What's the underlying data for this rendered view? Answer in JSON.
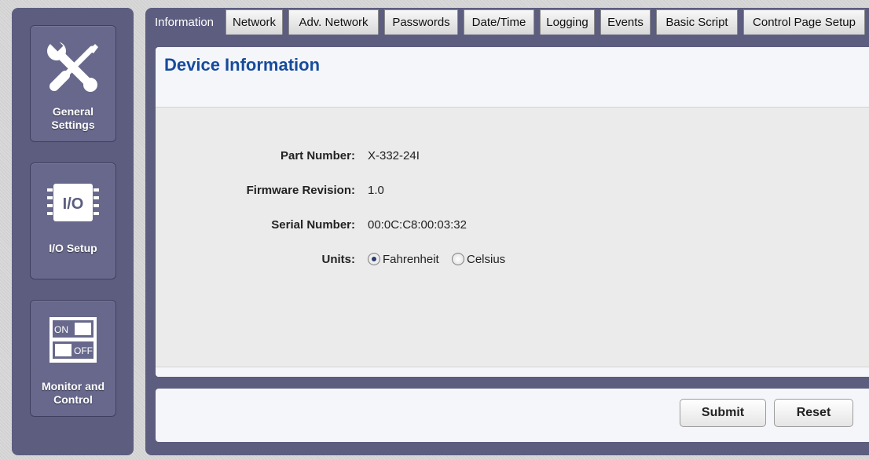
{
  "sidebar": {
    "items": [
      {
        "label_line1": "General",
        "label_line2": "Settings",
        "icon": "wrench-screwdriver-icon"
      },
      {
        "label": "I/O Setup",
        "icon": "io-chip-icon",
        "icon_text": "I/O"
      },
      {
        "label_line1": "Monitor and",
        "label_line2": "Control",
        "icon": "on-off-switch-icon",
        "switch_on": "ON",
        "switch_off": "OFF"
      }
    ]
  },
  "tabs": [
    "Information",
    "Network",
    "Adv. Network",
    "Passwords",
    "Date/Time",
    "Logging",
    "Events",
    "Basic Script",
    "Control Page Setup"
  ],
  "active_tab": "Information",
  "panel": {
    "title": "Device Information",
    "fields": [
      {
        "label": "Part Number:",
        "value": "X-332-24I"
      },
      {
        "label": "Firmware Revision:",
        "value": "1.0"
      },
      {
        "label": "Serial Number:",
        "value": "00:0C:C8:00:03:32"
      }
    ],
    "units": {
      "label": "Units:",
      "options": [
        "Fahrenheit",
        "Celsius"
      ],
      "selected": "Fahrenheit"
    }
  },
  "buttons": {
    "submit": "Submit",
    "reset": "Reset"
  },
  "colors": {
    "panel_bg": "#5c5d7f",
    "title": "#174b9c"
  }
}
